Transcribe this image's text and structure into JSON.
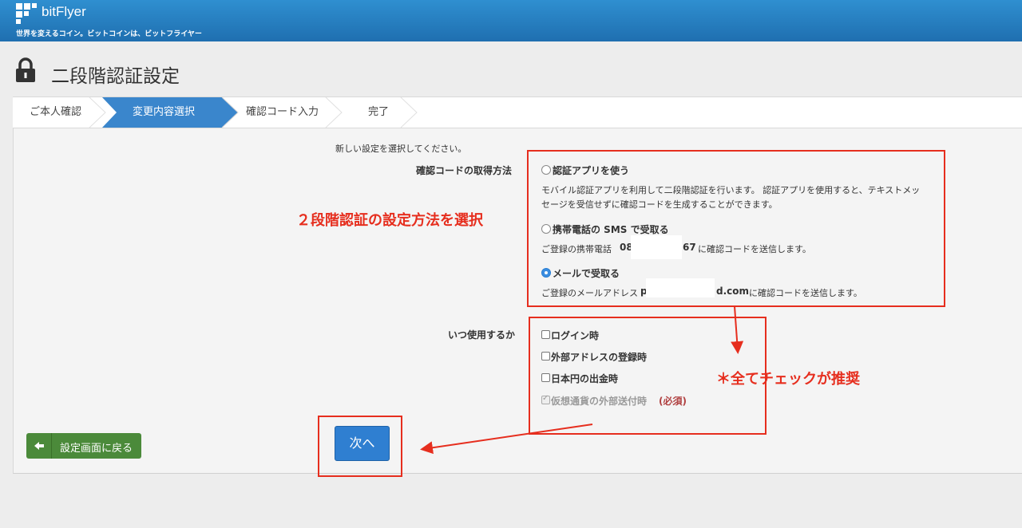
{
  "header": {
    "brand": "bitFlyer",
    "tagline": "世界を変えるコイン。ビットコインは、ビットフライヤー"
  },
  "page": {
    "title": "二段階認証設定"
  },
  "steps": [
    "ご本人確認",
    "変更内容選択",
    "確認コード入力",
    "完了"
  ],
  "form": {
    "intro": "新しい設定を選択してください。",
    "method_label": "確認コードの取得方法",
    "options": {
      "app": {
        "label": "認証アプリを使う",
        "desc_line1": "モバイル認証アプリを利用して二段階認証を行います。 認証アプリを使用すると、テキストメッ",
        "desc_line2": "セージを受信せずに確認コードを生成することができます。"
      },
      "sms": {
        "label": "携帯電話の SMS で受取る",
        "desc_prefix": "ご登録の携帯電話",
        "phone_start": "08",
        "phone_end": "67",
        "desc_suffix": "に確認コードを送信します。"
      },
      "email": {
        "label": "メールで受取る",
        "desc_prefix": "ご登録のメールアドレス",
        "email_start": "p",
        "email_end": "d.com",
        "desc_suffix": "に確認コードを送信します。"
      }
    },
    "when_label": "いつ使用するか",
    "checks": {
      "login": "ログイン時",
      "address": "外部アドレスの登録時",
      "jpy": "日本円の出金時",
      "crypto": "仮想通貨の外部送付時",
      "required": "(必須)"
    }
  },
  "buttons": {
    "back": "設定画面に戻る",
    "next": "次へ"
  },
  "annotations": {
    "choose_method": "２段階認証の設定方法を選択",
    "check_all": "＊全てチェックが推奨"
  },
  "colors": {
    "header": "#2176b8",
    "step_active": "#3a86cc",
    "annotation": "#e62e1e",
    "back_button": "#4b8a3a",
    "next_button": "#2f7fd1"
  }
}
